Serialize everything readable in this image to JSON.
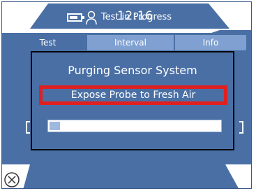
{
  "status": {
    "time": "12:16",
    "battery_level": 0.8
  },
  "tabs": [
    {
      "label": "Test",
      "active": true
    },
    {
      "label": "Interval",
      "active": false
    },
    {
      "label": "Info",
      "active": false
    }
  ],
  "dialog": {
    "title": "Purging Sensor System",
    "message": "Expose Probe to Fresh Air",
    "progress": 0.06
  },
  "footer": {
    "status_text": "Test in Progress"
  },
  "colors": {
    "screen_blue": "#4a6fa5",
    "tab_inactive": "#7fa0d0",
    "highlight_red": "#e02020"
  },
  "icons": {
    "battery": "battery-icon",
    "user": "user-icon",
    "close": "close-circle-icon"
  }
}
